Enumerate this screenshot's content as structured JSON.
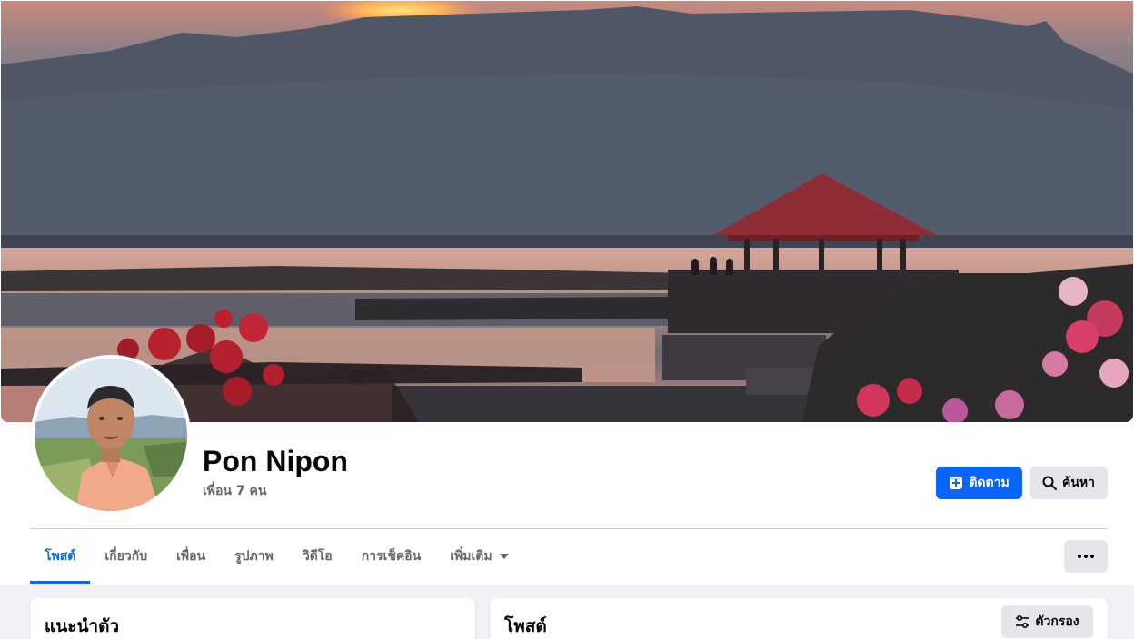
{
  "profile": {
    "name": "Pon Nipon",
    "friends_text": "เพื่อน 7 คน"
  },
  "actions": {
    "follow_label": "ติดตาม",
    "search_label": "ค้นหา"
  },
  "tabs": [
    {
      "label": "โพสต์",
      "active": true
    },
    {
      "label": "เกี่ยวกับ",
      "active": false
    },
    {
      "label": "เพื่อน",
      "active": false
    },
    {
      "label": "รูปภาพ",
      "active": false
    },
    {
      "label": "วิดีโอ",
      "active": false
    },
    {
      "label": "การเช็คอิน",
      "active": false
    },
    {
      "label": "เพิ่มเติม",
      "active": false,
      "has_dropdown": true
    }
  ],
  "intro_card": {
    "title": "แนะนำตัว"
  },
  "posts_card": {
    "title": "โพสต์",
    "filter_label": "ตัวกรอง"
  },
  "colors": {
    "accent": "#0866ff",
    "secondary_button": "#e4e6eb",
    "page_background": "#f0f2f5",
    "muted_text": "#65676b"
  },
  "icons": {
    "follow": "follow-icon",
    "search": "search-icon",
    "more": "more-dots-icon",
    "filter": "filter-icon",
    "tab_dropdown": "caret-down-icon"
  }
}
